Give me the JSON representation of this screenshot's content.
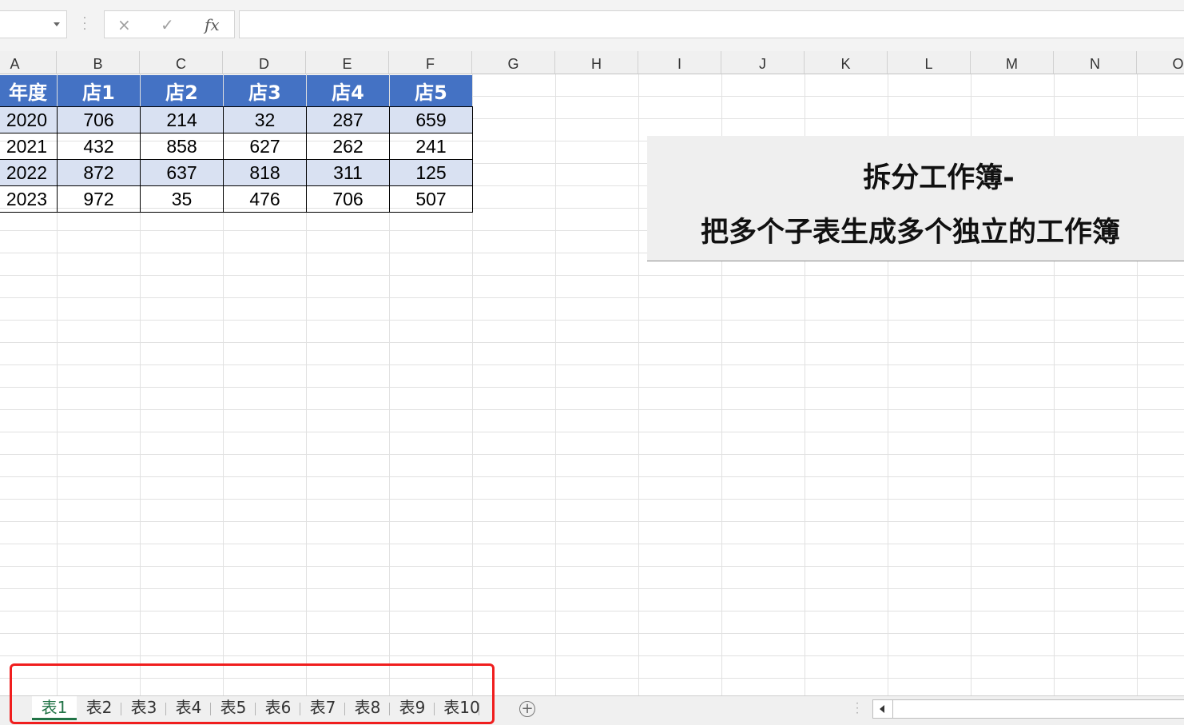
{
  "formula_bar": {
    "name_box_value": "",
    "cancel_icon": "×",
    "enter_icon": "✓",
    "fx_label": "fx",
    "formula_value": ""
  },
  "columns": [
    "A",
    "B",
    "C",
    "D",
    "E",
    "F",
    "G",
    "H",
    "I",
    "J",
    "K",
    "L",
    "M",
    "N",
    "O"
  ],
  "table": {
    "header": [
      "年度",
      "店1",
      "店2",
      "店3",
      "店4",
      "店5"
    ],
    "rows": [
      [
        "2020",
        "706",
        "214",
        "32",
        "287",
        "659"
      ],
      [
        "2021",
        "432",
        "858",
        "627",
        "262",
        "241"
      ],
      [
        "2022",
        "872",
        "637",
        "818",
        "311",
        "125"
      ],
      [
        "2023",
        "972",
        "35",
        "476",
        "706",
        "507"
      ]
    ]
  },
  "title_box": {
    "line1": "拆分工作簿-",
    "line2": "把多个子表生成多个独立的工作簿"
  },
  "sheet_tabs": [
    "表1",
    "表2",
    "表3",
    "表4",
    "表5",
    "表6",
    "表7",
    "表8",
    "表9",
    "表10"
  ],
  "active_sheet": "表1",
  "add_sheet_icon": "+",
  "colors": {
    "header_fill": "#4472c4",
    "band_fill": "#d9e1f2",
    "active_tab": "#217346",
    "highlight_box": "#f01e1e"
  }
}
